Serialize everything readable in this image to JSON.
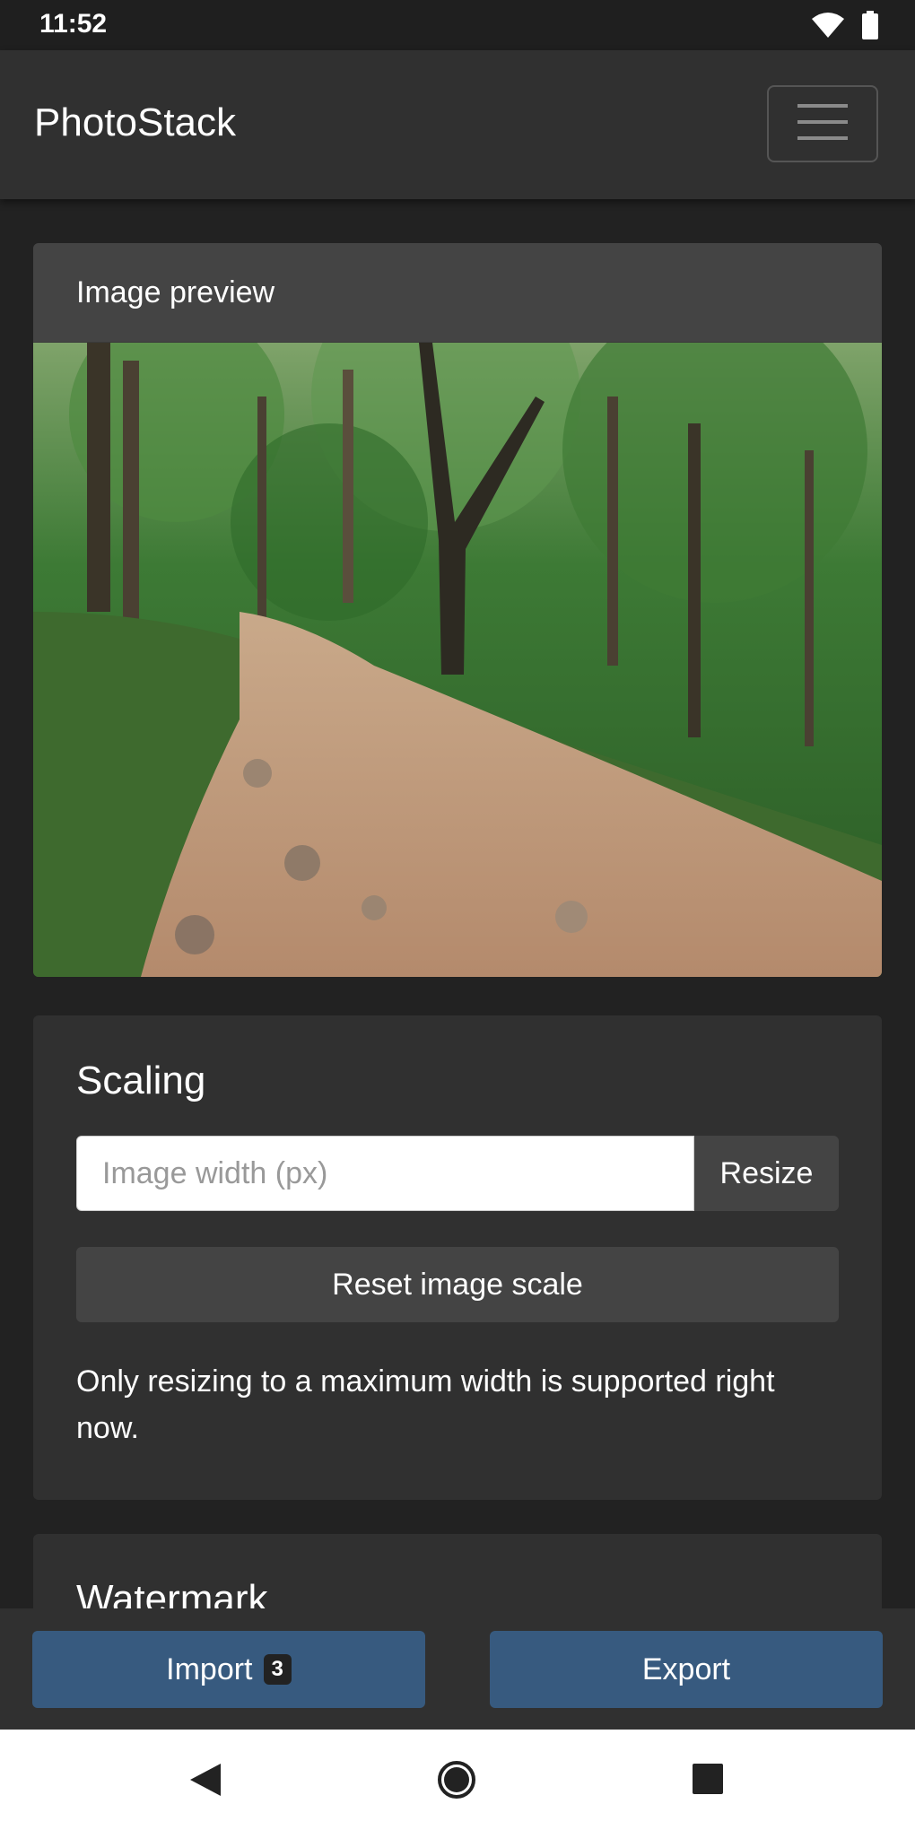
{
  "status_bar": {
    "time": "11:52"
  },
  "navbar": {
    "brand": "PhotoStack"
  },
  "preview_card": {
    "header": "Image preview"
  },
  "scaling": {
    "title": "Scaling",
    "width_placeholder": "Image width (px)",
    "width_value": "",
    "resize_label": "Resize",
    "reset_label": "Reset image scale",
    "note": "Only resizing to a maximum width is supported right now."
  },
  "watermark": {
    "title": "Watermark"
  },
  "actions": {
    "import_label": "Import",
    "import_count": "3",
    "export_label": "Export"
  },
  "colors": {
    "background": "#222222",
    "surface": "#303030",
    "card_header": "#444444",
    "primary": "#375a7f"
  },
  "icons": [
    "wifi-icon",
    "battery-icon",
    "hamburger-menu-icon",
    "back-icon",
    "home-icon",
    "recents-icon"
  ]
}
